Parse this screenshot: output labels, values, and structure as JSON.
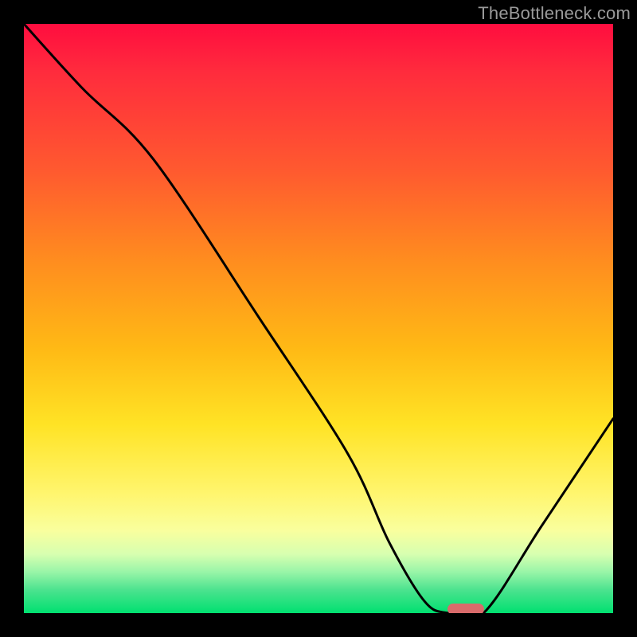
{
  "watermark": "TheBottleneck.com",
  "chart_data": {
    "type": "line",
    "title": "",
    "xlabel": "",
    "ylabel": "",
    "xlim": [
      0,
      100
    ],
    "ylim": [
      0,
      100
    ],
    "background_gradient": [
      "#ff0d3f",
      "#ff8c1f",
      "#ffe325",
      "#f9ff9e",
      "#00e070"
    ],
    "series": [
      {
        "name": "bottleneck-curve",
        "x": [
          0,
          10,
          22,
          40,
          55,
          62,
          68,
          72,
          78,
          88,
          100
        ],
        "values": [
          100,
          89,
          77,
          50,
          27,
          12,
          2,
          0,
          0,
          15,
          33
        ]
      }
    ],
    "marker": {
      "name": "optimal-point",
      "x": 75,
      "y": 0,
      "color": "#d96b6b"
    }
  }
}
